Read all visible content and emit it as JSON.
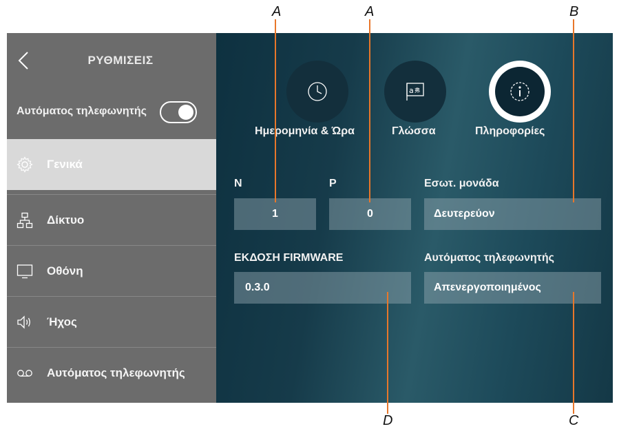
{
  "callouts": {
    "a1": "A",
    "a2": "A",
    "b": "B",
    "c": "C",
    "d": "D"
  },
  "sidebar": {
    "title": "ΡΥΘΜΙΣΕΙΣ",
    "answering_machine_label": "Αυτόματος τηλεφωνητής",
    "answering_machine_toggle_on": true,
    "items": [
      {
        "label": "Γενικά",
        "icon": "gear-icon",
        "active": true
      },
      {
        "label": "Δίκτυο",
        "icon": "network-icon",
        "active": false
      },
      {
        "label": "Οθόνη",
        "icon": "monitor-icon",
        "active": false
      },
      {
        "label": "Ήχος",
        "icon": "speaker-icon",
        "active": false
      },
      {
        "label": "Αυτόματος τηλεφωνητής",
        "icon": "voicemail-icon",
        "active": false
      }
    ]
  },
  "tabs": [
    {
      "label": "Ημερομηνία & Ώρα",
      "icon": "clock-icon",
      "selected": false
    },
    {
      "label": "Γλώσσα",
      "icon": "language-icon",
      "selected": false
    },
    {
      "label": "Πληροφορίες",
      "icon": "info-icon",
      "selected": true
    }
  ],
  "info": {
    "n_label": "N",
    "n_value": "1",
    "p_label": "P",
    "p_value": "0",
    "internal_unit_label": "Εσωτ. μονάδα",
    "internal_unit_value": "Δευτερεύον",
    "firmware_label": "ΕΚΔΟΣΗ FIRMWARE",
    "firmware_value": "0.3.0",
    "answering_machine_label": "Αυτόματος τηλεφωνητής",
    "answering_machine_value": "Απενεργοποιημένος"
  },
  "colors": {
    "callout_line": "#e8772a",
    "sidebar": "#6c6c6c",
    "active_item": "#d9d9d9"
  }
}
